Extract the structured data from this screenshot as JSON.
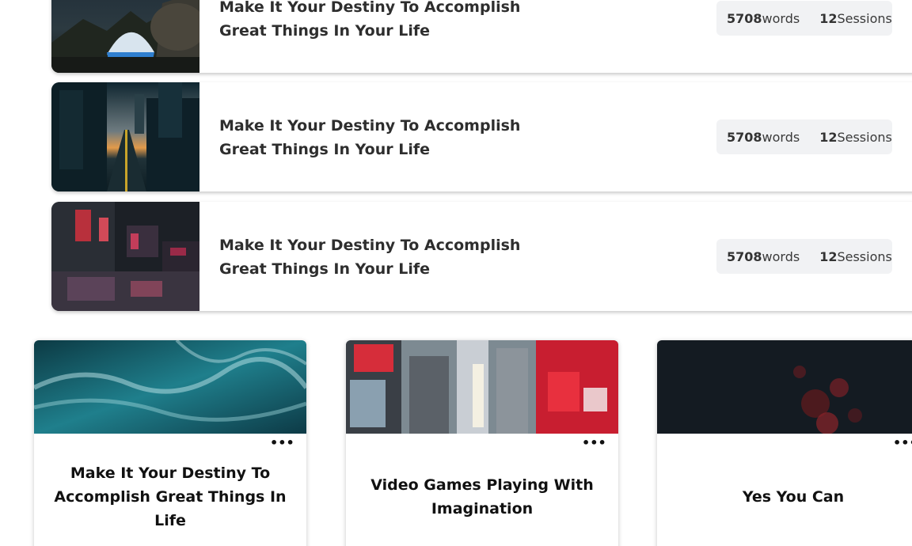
{
  "list_items": [
    {
      "title": "Make It Your Destiny To Accomplish Great Things In Your Life",
      "words_count": "5708",
      "words_unit": "words",
      "sessions_count": "12",
      "sessions_unit": "Sessions",
      "image": "tent-night-photo"
    },
    {
      "title": "Make It Your Destiny To Accomplish Great Things In Your Life",
      "words_count": "5708",
      "words_unit": "words",
      "sessions_count": "12",
      "sessions_unit": "Sessions",
      "image": "city-street-sunset-photo"
    },
    {
      "title": "Make It Your Destiny To Accomplish Great Things In Your Life",
      "words_count": "5708",
      "words_unit": "words",
      "sessions_count": "12",
      "sessions_unit": "Sessions",
      "image": "neon-street-rain-photo"
    }
  ],
  "grid_items": [
    {
      "title": "Make It Your Destiny To Accomplish Great Things In Life",
      "image": "ocean-waves-photo",
      "menu_icon": "more-dots-icon"
    },
    {
      "title": "Video Games Playing With Imagination",
      "image": "times-square-billboards-photo",
      "menu_icon": "more-dots-icon"
    },
    {
      "title": "Yes You Can",
      "image": "dark-red-bokeh-photo",
      "menu_icon": "more-dots-icon"
    }
  ],
  "menu_glyph": "•••"
}
